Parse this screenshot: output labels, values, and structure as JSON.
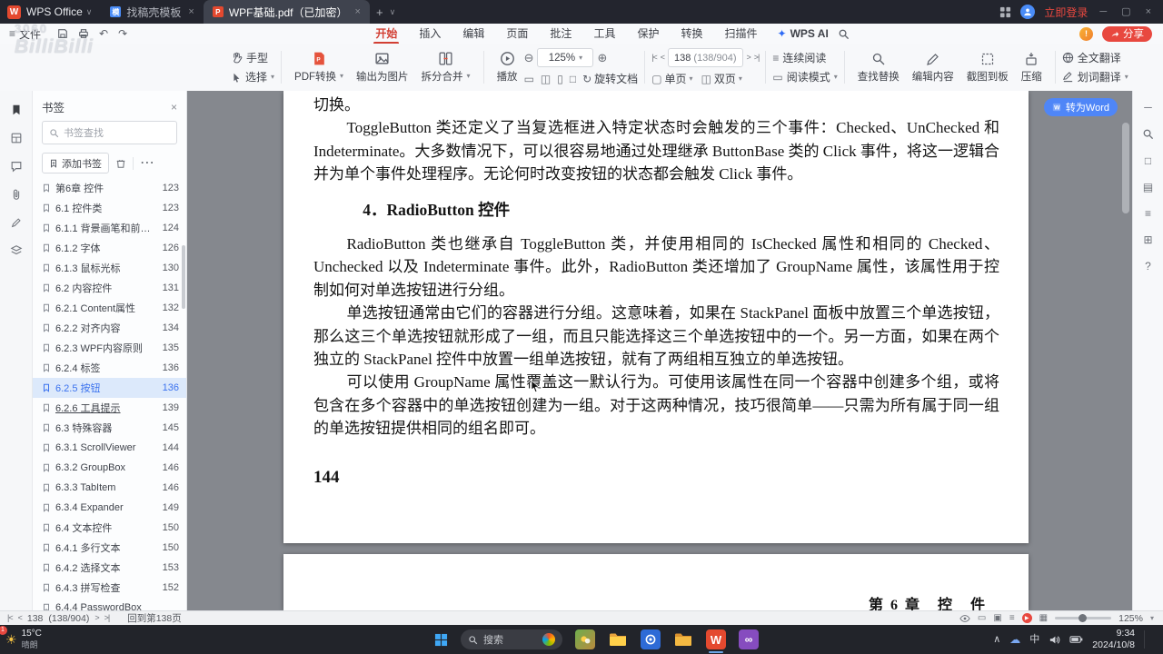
{
  "watermark": {
    "line1": "3060",
    "line2": "BilliBilli"
  },
  "titlebar": {
    "app_name": "WPS Office",
    "tab_template": "找稿壳模板",
    "tab_doc": "WPF基础.pdf（已加密）",
    "login": "立即登录"
  },
  "menubar": {
    "file": "文件",
    "tabs": [
      "开始",
      "插入",
      "编辑",
      "页面",
      "批注",
      "工具",
      "保护",
      "转换",
      "扫描件"
    ],
    "active_index": 0,
    "ai": "WPS AI",
    "share": "分享"
  },
  "toolbar": {
    "hand": "手型",
    "select": "选择",
    "pdf_convert": "PDF转换",
    "to_image": "输出为图片",
    "split_merge": "拆分合并",
    "play": "播放",
    "zoom": "125%",
    "rotate": "旋转文档",
    "page_current": "138",
    "page_total": "(138/904)",
    "single_page": "单页",
    "double_page": "双页",
    "continuous": "连续阅读",
    "read_mode": "阅读模式",
    "find_replace": "查找替换",
    "edit_content": "编辑内容",
    "screenshot": "截图到板",
    "compress": "压缩",
    "full_translate": "全文翻译",
    "word_translate": "划词翻译"
  },
  "sidebar": {
    "title": "书签",
    "search_placeholder": "书签查找",
    "add": "添加书签",
    "items": [
      {
        "label": "第6章 控件",
        "page": "123"
      },
      {
        "label": "6.1 控件类",
        "page": "123"
      },
      {
        "label": "6.1.1 背景画笔和前景画笔",
        "page": "124"
      },
      {
        "label": "6.1.2 字体",
        "page": "126"
      },
      {
        "label": "6.1.3 鼠标光标",
        "page": "130"
      },
      {
        "label": "6.2 内容控件",
        "page": "131"
      },
      {
        "label": "6.2.1 Content属性",
        "page": "132"
      },
      {
        "label": "6.2.2 对齐内容",
        "page": "134"
      },
      {
        "label": "6.2.3 WPF内容原则",
        "page": "135"
      },
      {
        "label": "6.2.4 标签",
        "page": "136"
      },
      {
        "label": "6.2.5 按钮",
        "page": "136",
        "selected": true
      },
      {
        "label": "6.2.6 工具提示",
        "page": "139",
        "underline": true
      },
      {
        "label": "6.3 特殊容器",
        "page": "145"
      },
      {
        "label": "6.3.1 ScrollViewer",
        "page": "144"
      },
      {
        "label": "6.3.2 GroupBox",
        "page": "146"
      },
      {
        "label": "6.3.3 TabItem",
        "page": "146"
      },
      {
        "label": "6.3.4 Expander",
        "page": "149"
      },
      {
        "label": "6.4 文本控件",
        "page": "150"
      },
      {
        "label": "6.4.1 多行文本",
        "page": "150"
      },
      {
        "label": "6.4.2 选择文本",
        "page": "153"
      },
      {
        "label": "6.4.3 拼写检查",
        "page": "152"
      },
      {
        "label": "6.4.4 PasswordBox",
        "page": ""
      }
    ]
  },
  "document": {
    "page1": {
      "blocks": [
        {
          "type": "p",
          "indent": false,
          "text": "切换。"
        },
        {
          "type": "p",
          "indent": true,
          "text": "ToggleButton 类还定义了当复选框进入特定状态时会触发的三个事件：Checked、UnChecked 和 Indeterminate。大多数情况下，可以很容易地通过处理继承 ButtonBase 类的 Click 事件，将这一逻辑合并为单个事件处理程序。无论何时改变按钮的状态都会触发 Click 事件。"
        },
        {
          "type": "h",
          "text": "4．RadioButton 控件"
        },
        {
          "type": "p",
          "indent": true,
          "text": "RadioButton 类也继承自 ToggleButton 类，并使用相同的 IsChecked 属性和相同的 Checked、Unchecked 以及 Indeterminate 事件。此外，RadioButton 类还增加了 GroupName 属性，该属性用于控制如何对单选按钮进行分组。"
        },
        {
          "type": "p",
          "indent": true,
          "text": "单选按钮通常由它们的容器进行分组。这意味着，如果在 StackPanel 面板中放置三个单选按钮，那么这三个单选按钮就形成了一组，而且只能选择这三个单选按钮中的一个。另一方面，如果在两个独立的 StackPanel 控件中放置一组单选按钮，就有了两组相互独立的单选按钮。"
        },
        {
          "type": "p",
          "indent": true,
          "text": "可以使用 GroupName 属性覆盖这一默认行为。可使用该属性在同一个容器中创建多个组，或将包含在多个容器中的单选按钮创建为一组。对于这两种情况，技巧很简单——只需为所有属于同一组的单选按钮提供相同的组名即可。"
        }
      ],
      "page_number": "144"
    },
    "page2": {
      "chapter_header": "第 6 章　控　件"
    }
  },
  "float": {
    "to_word": "转为Word"
  },
  "statusbar": {
    "page_current": "138",
    "page_total": "(138/904)",
    "back": "回到第138页",
    "zoom": "125%"
  },
  "taskbar": {
    "badge": "1",
    "temp": "15°C",
    "weather": "晴朗",
    "search_placeholder": "搜索",
    "wps_letter": "W",
    "vs_glyph": "∞",
    "time": "9:34",
    "date": "2024/10/8"
  },
  "icons": {
    "wps_logo_letter": "W",
    "pdf_letter": "P",
    "template_letter": "模",
    "chevron_down": "∨",
    "caret_down": "▾",
    "plus": "+",
    "close": "×",
    "minimize": "─",
    "maximize": "▢",
    "menu": "≡",
    "undo": "↶",
    "redo": "↷",
    "zoom_out": "⊖",
    "zoom_in": "⊕",
    "rotate": "↻",
    "first_page": "|<",
    "prev_page": "<",
    "next_page": ">",
    "last_page": ">|",
    "more": "⋯",
    "collapse_up": "∧",
    "fit_a": "▭",
    "fit_b": "◫",
    "fit_c": "▯",
    "fit_d": "□",
    "continuous_glyph": "≡",
    "single_glyph": "▢",
    "double_glyph": "◫",
    "read_glyph": "▭",
    "help": "?",
    "grid_a": "▤",
    "grid_b": "⊞",
    "view_a": "▭",
    "view_b": "▣",
    "view_c": "≡",
    "view_d": "▦",
    "play_small": "▶",
    "ime": "中",
    "sun": "☀",
    "cloud": "☁",
    "spark": "✦",
    "battery": "▮",
    "orange_mark": "!"
  }
}
